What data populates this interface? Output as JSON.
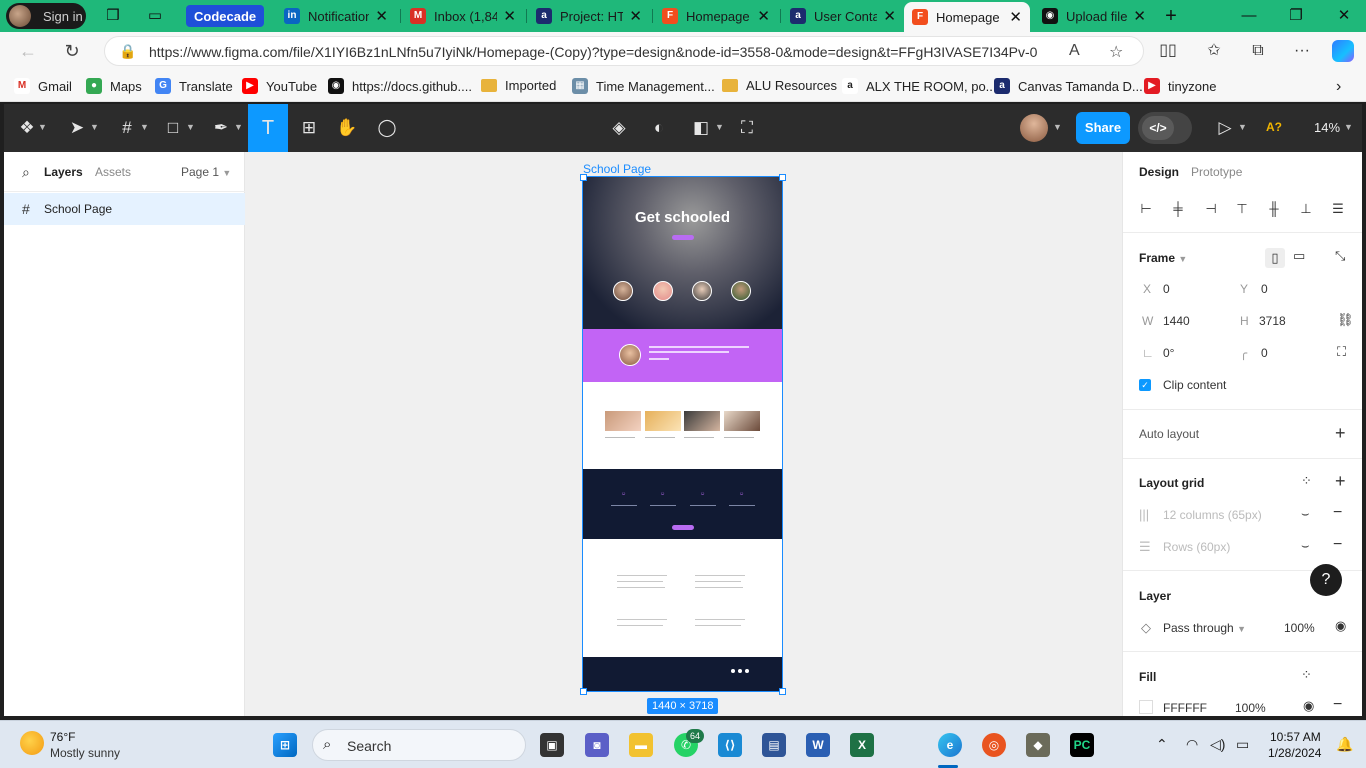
{
  "browser": {
    "profile_label": "Sign in",
    "tabs": [
      {
        "label": "Codecademy",
        "favicon": "codecademy-icon",
        "color": "#1f4fd8"
      },
      {
        "label": "Notification",
        "favicon": "linkedin-icon",
        "color": "#0a66c2"
      },
      {
        "label": "Inbox (1,84",
        "favicon": "gmail-icon",
        "color": "#d93025"
      },
      {
        "label": "Project: HT",
        "favicon": "alx-icon",
        "color": "#1c2b6e"
      },
      {
        "label": "Homepage",
        "favicon": "figma-icon",
        "color": "#f24e1e"
      },
      {
        "label": "User Conta",
        "favicon": "alx-icon",
        "color": "#1c2b6e"
      },
      {
        "label": "Homepage",
        "favicon": "figma-icon",
        "color": "#f24e1e",
        "active": true
      },
      {
        "label": "Upload file",
        "favicon": "github-icon",
        "color": "#111111"
      }
    ],
    "url": "https://www.figma.com/file/X1IYI6Bz1nLNfn5u7IyiNk/Homepage-(Copy)?type=design&node-id=3558-0&mode=design&t=FFgH3IVASE7I34Pv-0",
    "bookmarks": [
      {
        "label": "Gmail",
        "icon": "gmail-icon"
      },
      {
        "label": "Maps",
        "icon": "maps-icon"
      },
      {
        "label": "Translate",
        "icon": "translate-icon"
      },
      {
        "label": "YouTube",
        "icon": "youtube-icon"
      },
      {
        "label": "https://docs.github....",
        "icon": "github-icon"
      },
      {
        "label": "Imported",
        "icon": "folder-icon"
      },
      {
        "label": "Time Management...",
        "icon": "page-icon"
      },
      {
        "label": "ALU Resources",
        "icon": "folder-icon"
      },
      {
        "label": "ALX THE ROOM, po...",
        "icon": "alx-icon"
      },
      {
        "label": "Canvas Tamanda D...",
        "icon": "canvas-icon"
      },
      {
        "label": "tinyzone",
        "icon": "play-icon"
      }
    ]
  },
  "figma": {
    "toolbar": {
      "share_label": "Share",
      "zoom": "14%",
      "warning": "A?"
    },
    "left_panel": {
      "tab_layers": "Layers",
      "tab_assets": "Assets",
      "page_selector": "Page 1",
      "layers": [
        {
          "name": "School Page",
          "type": "frame"
        }
      ]
    },
    "canvas": {
      "frame_label": "School Page",
      "dimension_badge": "1440 × 3718",
      "mini_page": {
        "hero_title": "Get schooled"
      }
    },
    "right_panel": {
      "tab_design": "Design",
      "tab_prototype": "Prototype",
      "frame_header": "Frame",
      "x_label": "X",
      "x_value": "0",
      "y_label": "Y",
      "y_value": "0",
      "w_label": "W",
      "w_value": "1440",
      "h_label": "H",
      "h_value": "3718",
      "rotation": "0°",
      "radius": "0",
      "clip_content": "Clip content",
      "auto_layout": "Auto layout",
      "layout_grid": "Layout grid",
      "grid_columns": "12 columns (65px)",
      "grid_rows": "Rows (60px)",
      "layer_header": "Layer",
      "blend_mode": "Pass through",
      "layer_opacity": "100%",
      "fill_header": "Fill",
      "fill_hex": "FFFFFF",
      "fill_opacity": "100%"
    }
  },
  "taskbar": {
    "temperature": "76°F",
    "weather": "Mostly sunny",
    "search_placeholder": "Search",
    "whatsapp_badge": "64",
    "time": "10:57 AM",
    "date": "1/28/2024"
  }
}
